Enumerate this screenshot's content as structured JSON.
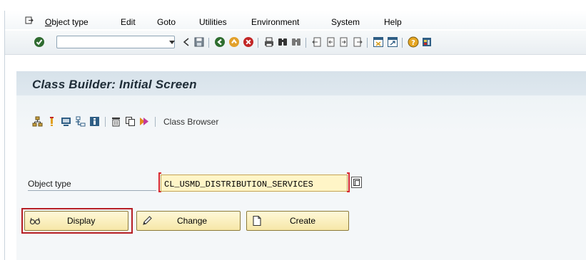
{
  "menu": {
    "items": [
      {
        "label": "Object type",
        "mnemonic": "O"
      },
      {
        "label": "Edit"
      },
      {
        "label": "Goto"
      },
      {
        "label": "Utilities"
      },
      {
        "label": "Environment"
      },
      {
        "label": "System"
      },
      {
        "label": "Help"
      }
    ]
  },
  "toolbar": {
    "command_field_value": "",
    "icons": [
      "enter-icon",
      "dropdown-icon",
      "back-arrow-icon",
      "save-icon",
      "back-icon",
      "exit-icon",
      "cancel-icon",
      "print-icon",
      "find-icon",
      "find-next-icon",
      "first-page-icon",
      "previous-page-icon",
      "next-page-icon",
      "last-page-icon",
      "create-session-icon",
      "shortcut-icon",
      "help-icon",
      "customize-layout-icon"
    ]
  },
  "title": "Class Builder: Initial Screen",
  "app_toolbar": {
    "icons": [
      "hierarchy-icon",
      "info-icon",
      "test-icon",
      "where-used-icon",
      "information-icon",
      "delete-icon",
      "copy-icon",
      "activate-icon"
    ],
    "class_browser_label": "Class Browser"
  },
  "form": {
    "object_type_label": "Object type",
    "object_type_value": "CL_USMD_DISTRIBUTION_SERVICES"
  },
  "buttons": {
    "display": "Display",
    "change": "Change",
    "create": "Create"
  },
  "colors": {
    "required_marker": "#d8282d",
    "field_background": "#fff5c7",
    "title_background": "#d7e2ea",
    "highlight_frame": "#b61e24"
  }
}
